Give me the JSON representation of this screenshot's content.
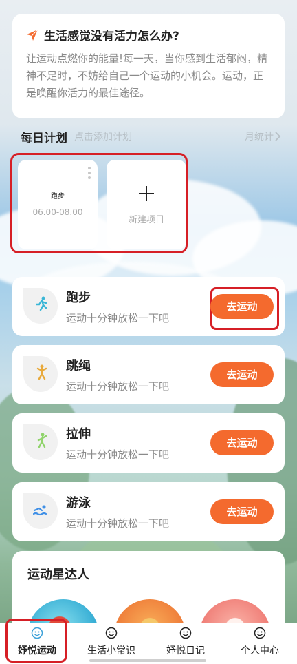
{
  "intro": {
    "title": "生活感觉没有活力怎么办?",
    "body": "让运动点燃你的能量!每一天，当你感到生活郁闷，精神不足时，不妨给自己一个运动的小机会。运动，正是唤醒你活力的最佳途径。"
  },
  "plan": {
    "title": "每日计划",
    "subtitle": "点击添加计划",
    "month_link": "月统计",
    "items": [
      {
        "name": "跑步",
        "time": "06.00-08.00"
      }
    ],
    "new_label": "新建项目"
  },
  "activities": [
    {
      "name": "跑步",
      "desc": "运动十分钟放松一下吧",
      "button": "去运动",
      "icon": "running-icon",
      "color": "#3ab6d6"
    },
    {
      "name": "跳绳",
      "desc": "运动十分钟放松一下吧",
      "button": "去运动",
      "icon": "jump-rope-icon",
      "color": "#e8a93b"
    },
    {
      "name": "拉伸",
      "desc": "运动十分钟放松一下吧",
      "button": "去运动",
      "icon": "stretching-icon",
      "color": "#8fd36a"
    },
    {
      "name": "游泳",
      "desc": "运动十分钟放松一下吧",
      "button": "去运动",
      "icon": "swimming-icon",
      "color": "#3f8fe6"
    }
  ],
  "stars": {
    "title": "运动星达人"
  },
  "tabs": [
    {
      "label": "妤悦运动",
      "active": true
    },
    {
      "label": "生活小常识",
      "active": false
    },
    {
      "label": "妤悦日记",
      "active": false
    },
    {
      "label": "个人中心",
      "active": false
    }
  ],
  "colors": {
    "accent": "#f46a2e",
    "highlight": "#d61f26",
    "active_tab": "#3aa0d8"
  }
}
